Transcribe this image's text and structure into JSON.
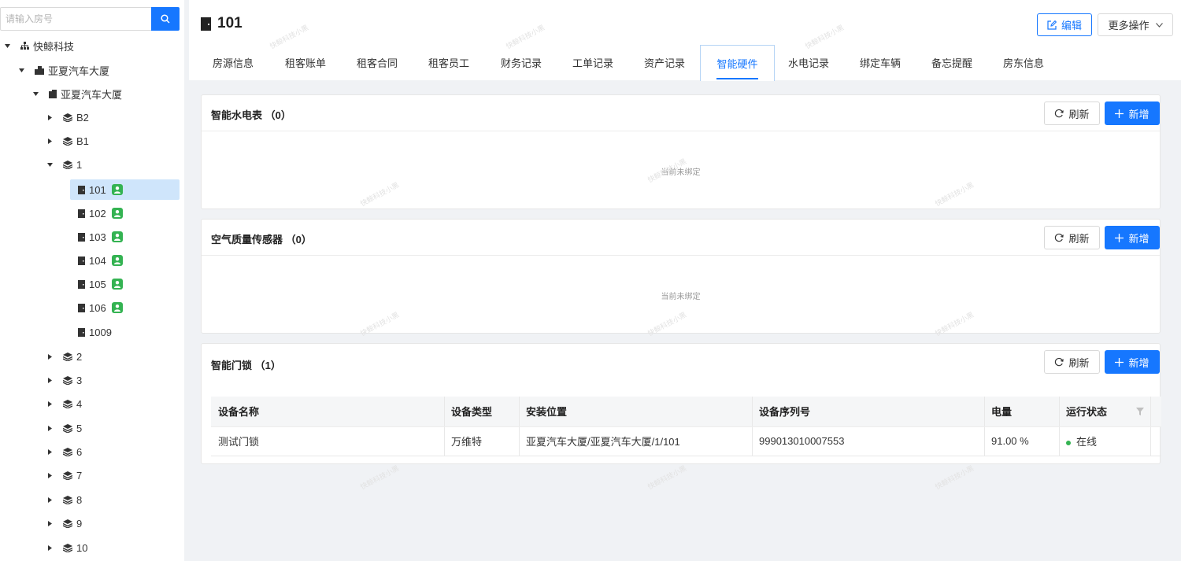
{
  "search": {
    "placeholder": "请输入房号"
  },
  "tree": {
    "org": "快鲸科技",
    "park": "亚夏汽车大厦",
    "building": "亚夏汽车大厦",
    "floors_top": [
      "B2",
      "B1",
      "1"
    ],
    "rooms": [
      "101",
      "102",
      "103",
      "104",
      "105",
      "106",
      "1009"
    ],
    "floors_bottom": [
      "2",
      "3",
      "4",
      "5",
      "6",
      "7",
      "8",
      "9",
      "10"
    ]
  },
  "header": {
    "title": "101",
    "edit_label": "编辑",
    "more_label": "更多操作"
  },
  "tabs": [
    "房源信息",
    "租客账单",
    "租客合同",
    "租客员工",
    "财务记录",
    "工单记录",
    "资产记录",
    "智能硬件",
    "水电记录",
    "绑定车辆",
    "备忘提醒",
    "房东信息"
  ],
  "active_tab": "智能硬件",
  "buttons": {
    "refresh": "刷新",
    "add": "新增"
  },
  "panels": {
    "meters": {
      "title": "智能水电表 （0）",
      "empty": "当前未绑定"
    },
    "air": {
      "title": "空气质量传感器 （0）",
      "empty": "当前未绑定"
    },
    "locks": {
      "title": "智能门锁 （1）",
      "columns": [
        "设备名称",
        "设备类型",
        "安装位置",
        "设备序列号",
        "电量",
        "运行状态"
      ],
      "rows": [
        {
          "name": "测试门锁",
          "type": "万维特",
          "location": "亚夏汽车大厦/亚夏汽车大厦/1/101",
          "serial": "999013010007553",
          "battery": "91.00 %",
          "status": "在线"
        }
      ]
    }
  },
  "watermark": "快鲸科技小黑",
  "colors": {
    "primary": "#1677ff",
    "online": "#34b352",
    "selected": "#cfe5fb"
  }
}
